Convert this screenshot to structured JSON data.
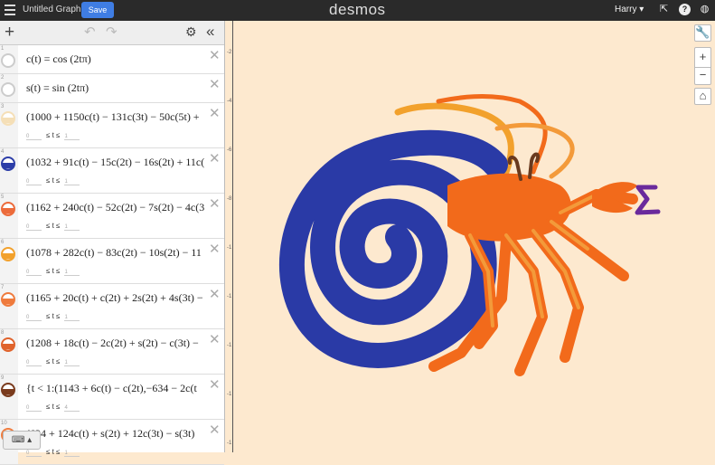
{
  "topbar": {
    "title": "Untitled Graph",
    "save_label": "Save",
    "logo": "desmos",
    "user": "Harry ▾"
  },
  "icons": {
    "menu": "hamburger-icon",
    "share": "share-icon",
    "help": "help-icon",
    "language": "globe-icon",
    "add": "plus-icon",
    "undo": "undo-icon",
    "redo": "redo-icon",
    "settings": "gear-icon",
    "collapse": "collapse-icon",
    "keyboard": "keyboard-icon",
    "wrench": "wrench-icon",
    "zoom_in": "zoom-in-icon",
    "zoom_out": "zoom-out-icon",
    "home": "home-icon"
  },
  "expressions": [
    {
      "num": "1",
      "latex": "c(t) = cos (2tπ)",
      "color": "#cccccc",
      "bounds": null
    },
    {
      "num": "2",
      "latex": "s(t) = sin (2tπ)",
      "color": "#cccccc",
      "bounds": null
    },
    {
      "num": "3",
      "latex": "(1000 + 1150c(t) − 131c(3t) − 50c(5t) +",
      "color": "#f5dfb7",
      "bounds": {
        "min": "0",
        "op1": "≤ t ≤",
        "max": "1"
      }
    },
    {
      "num": "4",
      "latex": "(1032 + 91c(t) − 15c(2t) − 16s(2t) + 11c(",
      "color": "#2d3ea8",
      "bounds": {
        "min": "0",
        "op1": "≤ t ≤",
        "max": "1"
      }
    },
    {
      "num": "5",
      "latex": "(1162 + 240c(t) − 52c(2t) − 7s(2t) − 4c(3",
      "color": "#ec6b3b",
      "bounds": {
        "min": "0",
        "op1": "≤ t ≤",
        "max": "1"
      }
    },
    {
      "num": "6",
      "latex": "(1078 + 282c(t) − 83c(2t) − 10s(2t) − 11",
      "color": "#f2a12c",
      "bounds": {
        "min": "0",
        "op1": "≤ t ≤",
        "max": "1"
      }
    },
    {
      "num": "7",
      "latex": "(1165 + 20c(t) + c(2t) + 2s(2t) + 4s(3t) −",
      "color": "#ef7b3d",
      "bounds": {
        "min": "0",
        "op1": "≤ t ≤",
        "max": "1"
      }
    },
    {
      "num": "8",
      "latex": "(1208 + 18c(t) − 2c(2t) + s(2t) − c(3t) −",
      "color": "#e0632c",
      "bounds": {
        "min": "0",
        "op1": "≤ t ≤",
        "max": "1"
      }
    },
    {
      "num": "9",
      "latex": "{t < 1:(1143 + 6c(t) − c(2t),−634 − 2c(t",
      "color": "#7a3b1d",
      "bounds": {
        "min": "0",
        "op1": "≤ t ≤",
        "max": "4"
      }
    },
    {
      "num": "10",
      "latex": "(634 + 124c(t) + s(2t) + 12c(3t) − s(3t)",
      "color": "#ef7b3d",
      "bounds": {
        "min": "0",
        "op1": "≤ t ≤",
        "max": "1"
      }
    }
  ],
  "graph": {
    "background": "#fde9cf",
    "y_ticks": [
      "-2",
      "-4",
      "-6",
      "-8",
      "-1",
      "-1",
      "-1",
      "-1",
      "-1"
    ],
    "colors": {
      "shell": "#2a3aa6",
      "crab": "#f26a1b",
      "crab_light": "#f39a3a",
      "antenna": "#f2a12c",
      "sigma": "#6a2a9c",
      "eye": "#6a3a1e"
    }
  }
}
